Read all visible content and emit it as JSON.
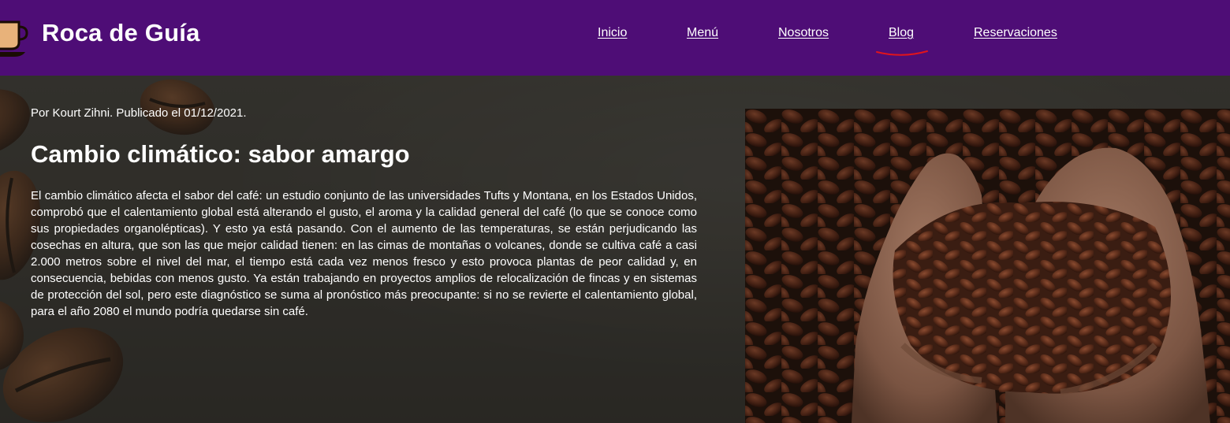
{
  "header": {
    "brand": "Roca de Guía",
    "logo_icon": "coffee-cup-icon",
    "nav": [
      {
        "label": "Inicio",
        "active": false
      },
      {
        "label": "Menú",
        "active": false
      },
      {
        "label": "Nosotros",
        "active": false
      },
      {
        "label": "Blog",
        "active": true
      },
      {
        "label": "Reservaciones",
        "active": false
      }
    ],
    "colors": {
      "background": "#4e0d76",
      "text": "#ffffff",
      "active_mark": "#e0141c"
    }
  },
  "article": {
    "byline": "Por Kourt Zihni. Publicado el 01/12/2021.",
    "title": "Cambio climático: sabor amargo",
    "body": "El cambio climático afecta el sabor del café: un estudio conjunto de las universidades Tufts y Montana, en los Estados Unidos, comprobó que el calentamiento global está alterando el gusto, el aroma y la calidad general del café (lo que se conoce como sus propiedades organolépticas). Y esto ya está pasando. Con el aumento de las temperaturas, se están perjudicando las cosechas en altura, que son las que mejor calidad tienen: en las cimas de montañas o volcanes, donde se cultiva café a casi 2.000 metros sobre el nivel del mar, el tiempo está cada vez menos fresco y esto provoca plantas de peor calidad y, en consecuencia, bebidas con menos gusto. Ya están trabajando en proyectos amplios de relocalización de fincas y en sistemas de protección del sol, pero este diagnóstico se suma al pronóstico más preocupante: si no se revierte el calentamiento global, para el año 2080 el mundo podría quedarse sin café."
  },
  "images": {
    "hero_background": "coffee-beans-background",
    "article_photo": "hands-holding-cacao-beans"
  }
}
